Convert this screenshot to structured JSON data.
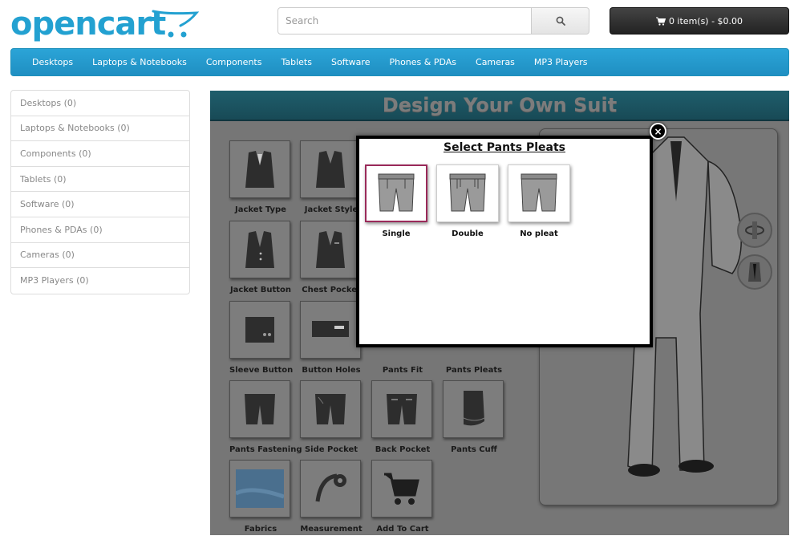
{
  "header": {
    "logo_text": "opencart",
    "search": {
      "placeholder": "Search"
    },
    "cart_label": "0 item(s) - $0.00"
  },
  "menu": [
    "Desktops",
    "Laptops & Notebooks",
    "Components",
    "Tablets",
    "Software",
    "Phones & PDAs",
    "Cameras",
    "MP3 Players"
  ],
  "sidebar": [
    "Desktops (0)",
    "Laptops & Notebooks (0)",
    "Components (0)",
    "Tablets (0)",
    "Software (0)",
    "Phones & PDAs (0)",
    "Cameras (0)",
    "MP3 Players (0)"
  ],
  "designer": {
    "title": "Design Your Own Suit",
    "options": [
      "Jacket Type",
      "Jacket Style",
      "Jacket Button",
      "Chest Pocket",
      "Sleeve Button",
      "Button Holes",
      "Pants Fit",
      "Pants Pleats",
      "Pants Fastening",
      "Side Pocket",
      "Back Pocket",
      "Pants Cuff",
      "Fabrics",
      "Measurement",
      "Add To Cart"
    ]
  },
  "modal": {
    "title": "Select Pants Pleats",
    "choices": [
      "Single",
      "Double",
      "No pleat"
    ],
    "selected": "Single"
  },
  "colors": {
    "brand": "#23a1d1",
    "menu": "#229ac8",
    "designer_bg": "#767676",
    "banner": "#1f5e6c",
    "selected_border": "#9a2a5a"
  }
}
